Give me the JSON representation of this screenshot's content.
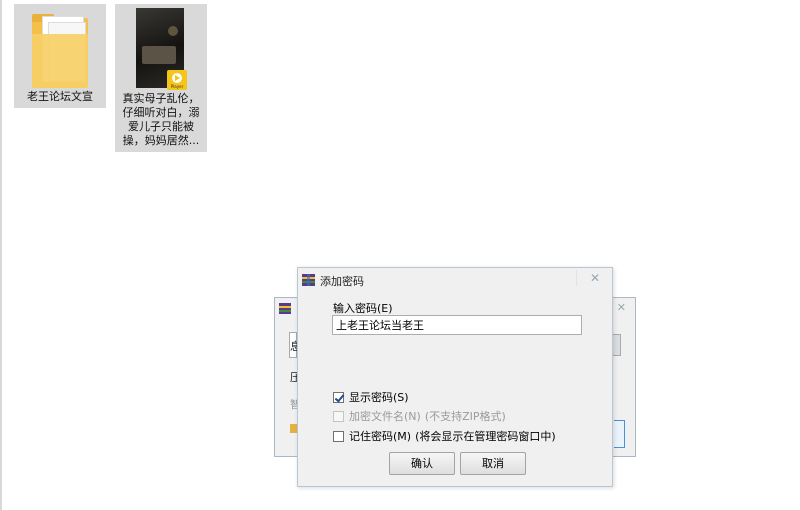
{
  "desktop": {
    "folder": {
      "label": "老王论坛文宣"
    },
    "video": {
      "label_lines": [
        "真实母子乱伦，",
        "仔细听对白，溺",
        "爱儿子只能被",
        "操，妈妈居然..."
      ],
      "badge": "Player"
    }
  },
  "back_dialog": {
    "frag_row1": "息",
    "frag_row2": "压",
    "frag_row3": "智"
  },
  "dialog": {
    "title": "添加密码",
    "close_glyph": "✕",
    "password_label": "输入密码(E)",
    "password_value": "上老王论坛当老王",
    "show_password": {
      "label": "显示密码(S)",
      "checked": true
    },
    "encrypt_filenames": {
      "label": "加密文件名(N)",
      "hint": "(不支持ZIP格式)",
      "checked": false,
      "disabled": true
    },
    "remember_password": {
      "label": "记住密码(M)",
      "hint": "(将会显示在管理密码窗口中)",
      "checked": false
    },
    "ok_label": "确认",
    "cancel_label": "取消"
  },
  "colors": {
    "title_blue": "#1f4c91",
    "folder_yellow": "#f3c04a",
    "badge_yellow": "#f5c518"
  }
}
